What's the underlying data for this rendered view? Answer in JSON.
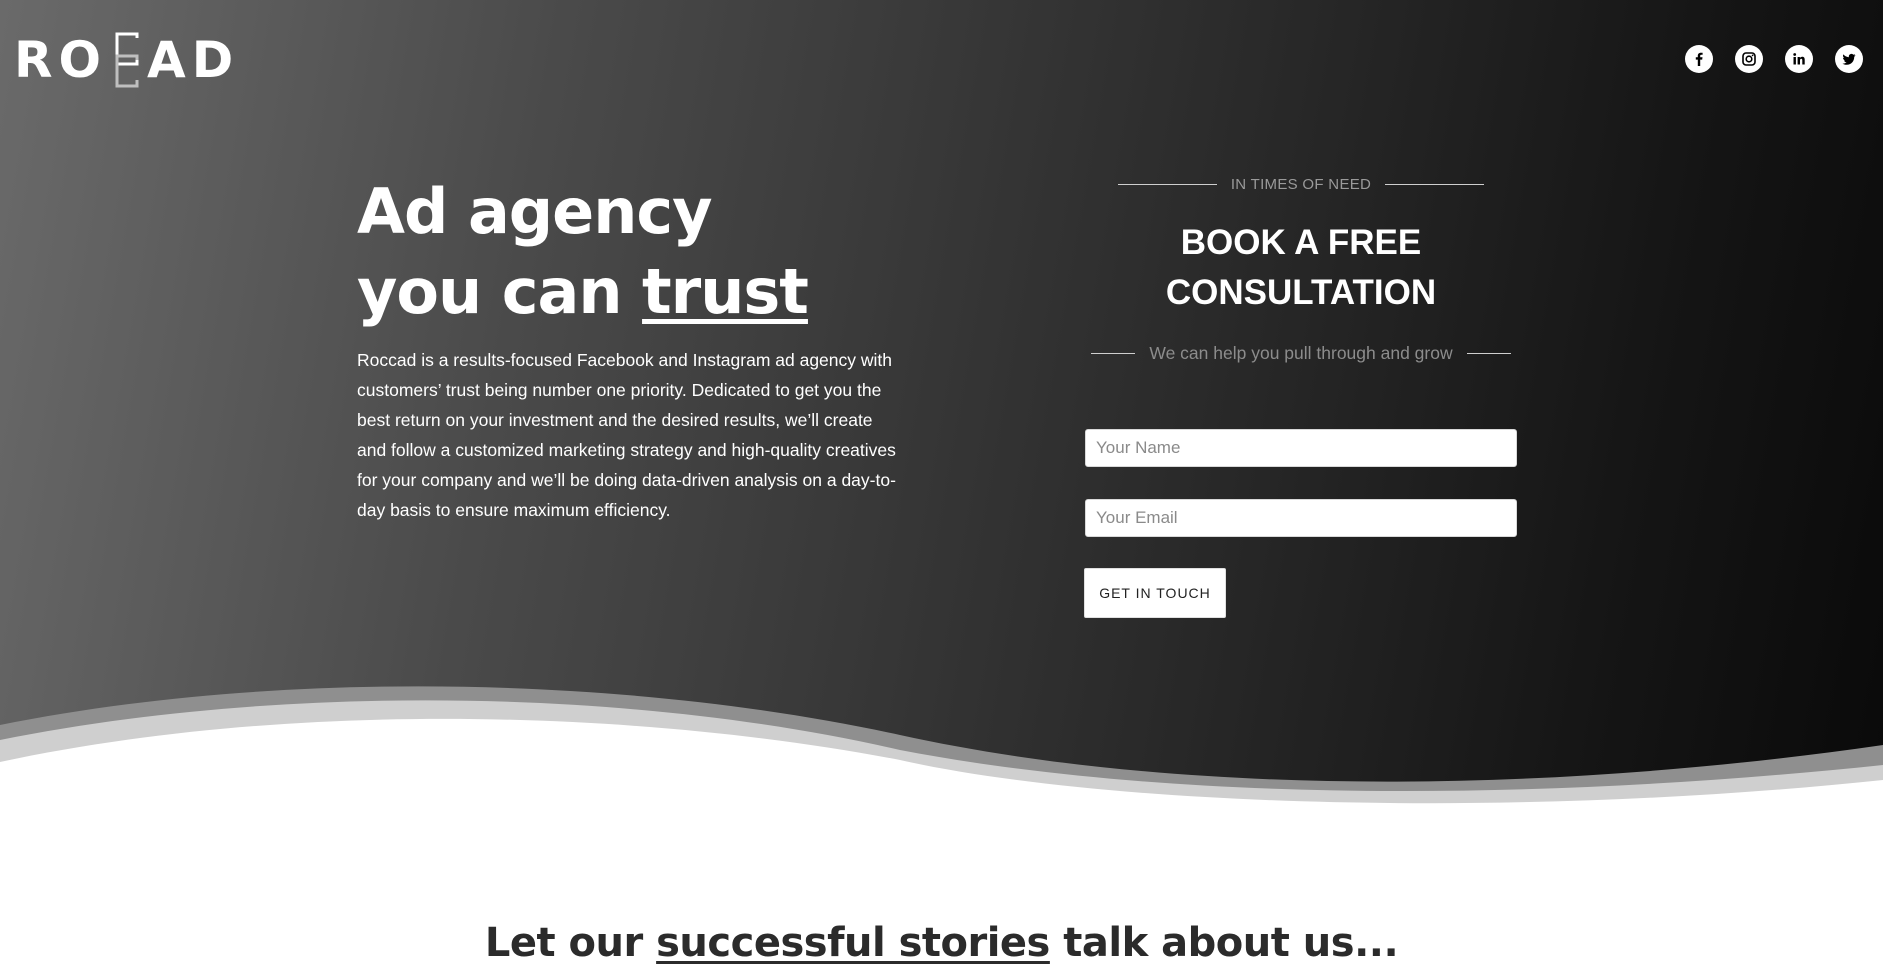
{
  "brand": {
    "logo_left": "RO",
    "logo_right": "AD",
    "logo_full": "ROCCAD"
  },
  "social": [
    {
      "icon": "facebook-icon",
      "glyph": "f"
    },
    {
      "icon": "instagram-icon"
    },
    {
      "icon": "linkedin-icon",
      "glyph": "in"
    },
    {
      "icon": "twitter-icon"
    }
  ],
  "hero": {
    "headline_line1": "Ad agency",
    "headline_line2_prefix": "you can ",
    "headline_line2_emphasis": "trust",
    "description": "Roccad is a results-focused Facebook and Instagram ad agency with customers’ trust being number one priority. Dedicated to get you the best return on your investment and the desired results, we’ll create and follow a customized marketing strategy and high-quality creatives for your company and we’ll be doing data-driven analysis on a day-to-day basis to ensure maximum efficiency."
  },
  "form": {
    "kicker": "IN TIMES OF NEED",
    "title_line1": "BOOK A FREE",
    "title_line2": "CONSULTATION",
    "tagline": "We can help you pull through and grow",
    "name_placeholder": "Your Name",
    "email_placeholder": "Your Email",
    "submit_label": "GET IN TOUCH"
  },
  "stories": {
    "prefix": "Let our ",
    "emphasis": "successful stories",
    "suffix": " talk about us..."
  },
  "colors": {
    "hero_dark": "#0a0a0a",
    "hero_light": "#6a6a6a",
    "text_white": "#ffffff",
    "heading_dark": "#2b2b2b",
    "wave_light": "#cfcfcf",
    "wave_mid": "#8f8f8f"
  }
}
